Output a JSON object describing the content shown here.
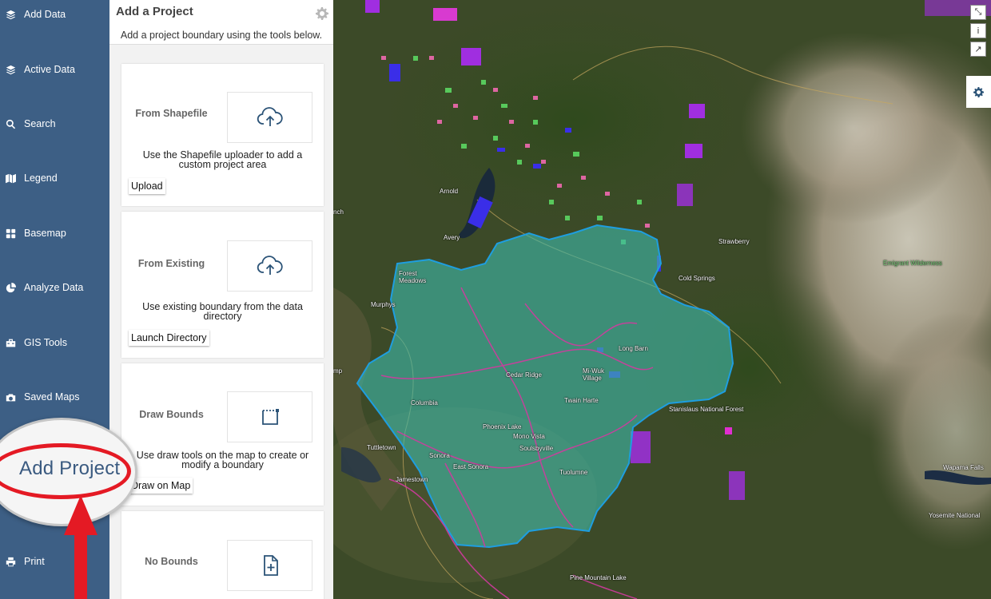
{
  "nav": {
    "items": [
      {
        "label": "Add Data",
        "icon": "layers-add-icon"
      },
      {
        "label": "Active Data",
        "icon": "layers-icon"
      },
      {
        "label": "Search",
        "icon": "search-icon"
      },
      {
        "label": "Legend",
        "icon": "map-icon"
      },
      {
        "label": "Basemap",
        "icon": "grid-icon"
      },
      {
        "label": "Analyze Data",
        "icon": "pie-chart-icon"
      },
      {
        "label": "GIS Tools",
        "icon": "toolbox-icon"
      },
      {
        "label": "Saved Maps",
        "icon": "saved-maps-icon"
      },
      {
        "label": "Print",
        "icon": "print-icon"
      }
    ]
  },
  "panel": {
    "title": "Add a Project",
    "subtitle": "Add a project boundary using the tools below.",
    "cards": [
      {
        "label": "From Shapefile",
        "icon": "cloud-upload-icon",
        "description": "Use the Shapefile uploader to add a custom project area",
        "button": "Upload"
      },
      {
        "label": "From Existing",
        "icon": "cloud-upload-icon",
        "description": "Use existing boundary from the data directory",
        "button": "Launch Directory"
      },
      {
        "label": "Draw Bounds",
        "icon": "draw-square-icon",
        "description": "Use draw tools on the map to create or modify a boundary",
        "button": "Draw on Map"
      },
      {
        "label": "No Bounds",
        "icon": "file-add-icon"
      }
    ]
  },
  "callout": {
    "label": "Add Project"
  },
  "map": {
    "labels": {
      "arnold": "Arnold",
      "avery": "Avery",
      "nch": "nch",
      "forest_meadows": "Forest\nMeadows",
      "murphys": "Murphys",
      "strawberry": "Strawberry",
      "cold_springs": "Cold Springs",
      "emigrant": "Emigrant Wilderness",
      "long_barn": "Long Barn",
      "cedar_ridge": "Cedar Ridge",
      "miwuk": "Mi-Wuk\nVillage",
      "twain_harte": "Twain Harte",
      "columbia": "Columbia",
      "stanislaus": "Stanislaus National Forest",
      "phoenix_lake": "Phoenix Lake",
      "mono_vista": "Mono Vista",
      "soulsbyville": "Soulsbyville",
      "sonora": "Sonora",
      "east_sonora": "East Sonora",
      "tuttletown": "Tuttletown",
      "jamestown": "Jamestown",
      "tuolumne": "Tuolumne",
      "wapama": "Wapama Falls",
      "yosemite": "Yosemite National",
      "pine_mountain": "Pine Mountain Lake",
      "mp": "mp"
    },
    "controls": {
      "zoom": "⤡",
      "info": "i",
      "share": "↗"
    },
    "colors": {
      "boundary_fill": "#3fb8a8",
      "boundary_stroke": "#1e9ee0",
      "roads": "#d23aa0",
      "parcels_purple": "#a02ee0",
      "parcels_green": "#5ee066",
      "parcels_pink": "#f06ab0",
      "parcels_blue": "#3a2ee8"
    }
  },
  "colors": {
    "nav_bg": "#3d5f85",
    "accent": "#2b5377",
    "callout_ring": "#e41a24"
  }
}
